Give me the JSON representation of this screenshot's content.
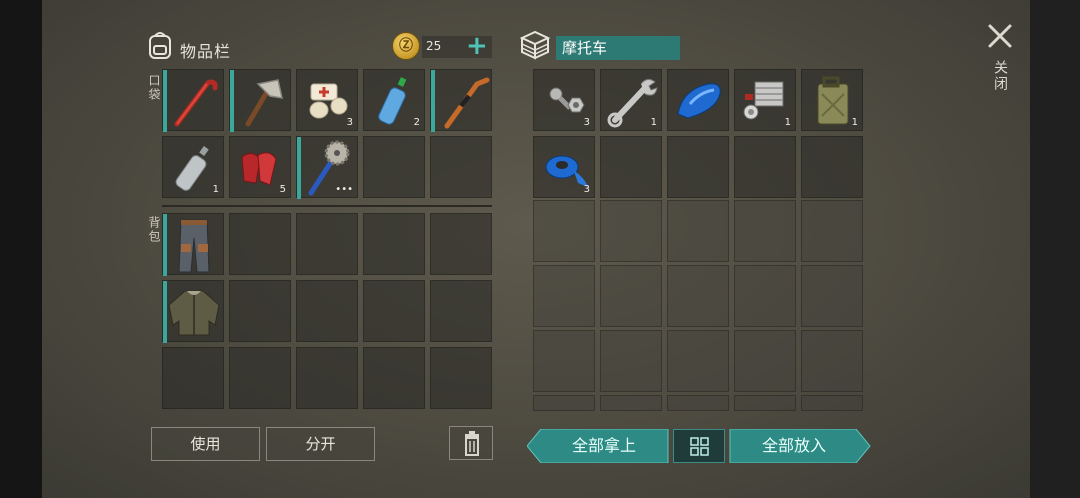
{
  "inventory": {
    "title": "物品栏",
    "coins": "25",
    "plus": "+",
    "pocket_label": "口袋",
    "backpack_label": "背包",
    "pocket_row1": [
      {
        "name": "crowbar",
        "count": ""
      },
      {
        "name": "hatchet",
        "count": ""
      },
      {
        "name": "bandage",
        "count": "3"
      },
      {
        "name": "water-bottle",
        "count": "2"
      },
      {
        "name": "hockey-stick",
        "count": ""
      }
    ],
    "pocket_row2": [
      {
        "name": "empty-bottle",
        "count": "1"
      },
      {
        "name": "red-cloth",
        "count": "5"
      },
      {
        "name": "sawblade-club",
        "count": "•••"
      }
    ],
    "backpack": [
      {
        "name": "pants"
      },
      {
        "name": "jacket"
      }
    ],
    "use_label": "使用",
    "split_label": "分开"
  },
  "container": {
    "title": "摩托车",
    "items": [
      {
        "name": "bolt-nut",
        "count": "3"
      },
      {
        "name": "wrench",
        "count": "1"
      },
      {
        "name": "fuel-tank",
        "count": ""
      },
      {
        "name": "engine",
        "count": "1"
      },
      {
        "name": "jerrycan",
        "count": "1"
      },
      {
        "name": "duct-tape",
        "count": "3"
      }
    ],
    "take_all_label": "全部拿上",
    "put_all_label": "全部放入"
  },
  "close": {
    "label": "关闭"
  },
  "colors": {
    "accent": "#3aa89c",
    "teal_button": "#2d8a84"
  }
}
